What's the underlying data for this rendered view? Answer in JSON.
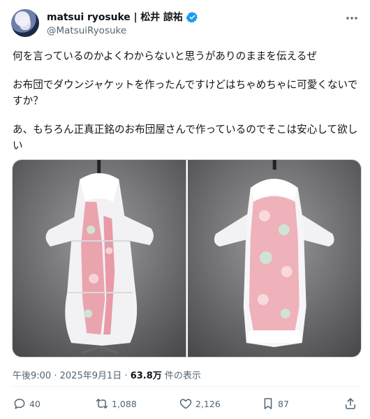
{
  "author": {
    "display_name": "matsui ryosuke | 松井 諒祐",
    "handle": "@MatsuiRyosuke",
    "verified": true,
    "verified_color": "#1d9bf0"
  },
  "tweet": {
    "paragraphs": [
      "何を言っているのかよくわからないと思うがありのままを伝えるぜ",
      "お布団でダウンジャケットを作ったんですけどはちゃめちゃに可愛くないですか？",
      "あ、もちろん正真正銘のお布団屋さんで作っているのでそこは安心して欲しい"
    ],
    "images": [
      {
        "icon": "futon-jacket-front-photo"
      },
      {
        "icon": "futon-jacket-back-photo"
      }
    ]
  },
  "meta": {
    "time": "午後9:00",
    "separator": "·",
    "date": "2025年9月1日",
    "views_count": "63.8万",
    "views_label": "件の表示"
  },
  "actions": {
    "reply_count": "40",
    "repost_count": "1,088",
    "like_count": "2,126",
    "bookmark_count": "87"
  },
  "icons": {
    "more": "more-icon",
    "reply": "reply-icon",
    "repost": "repost-icon",
    "like": "heart-icon",
    "bookmark": "bookmark-icon",
    "share": "share-icon"
  }
}
